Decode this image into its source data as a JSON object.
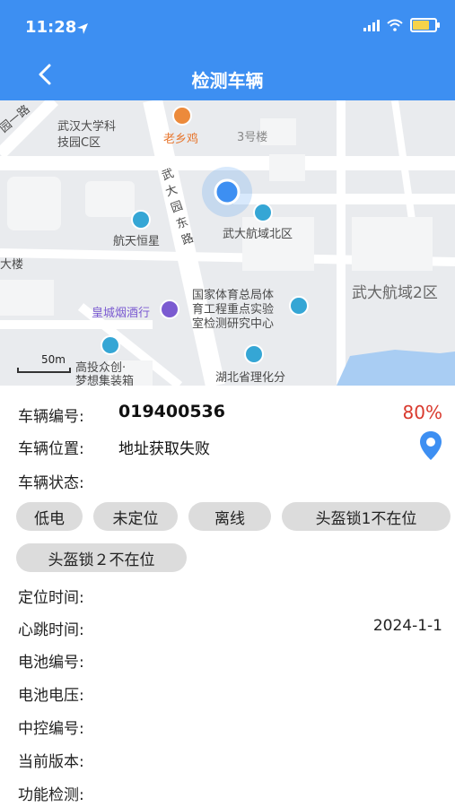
{
  "status": {
    "time": "11:28"
  },
  "header": {
    "title": "检测车辆",
    "back_icon": "back-chevron-icon"
  },
  "map": {
    "labels": [
      "武汉大学科",
      "技园C区",
      "老乡鸡",
      "3号楼",
      "武",
      "大",
      "园",
      "东",
      "路",
      "航天恒星",
      "武大航域北区",
      "武大航域2区",
      "大楼",
      "国家体育总局体",
      "育工程重点实验",
      "室检测研究中心",
      "皇城烟酒行",
      "湖北省理化分",
      "梦想集装箱",
      "高投众创·",
      "50m",
      "园一路"
    ]
  },
  "vehicle": {
    "number_label": "车辆编号:",
    "number_value": "019400536",
    "battery_percent": "80%",
    "location_label": "车辆位置:",
    "location_value": "地址获取失败",
    "status_label": "车辆状态:",
    "tags": [
      "低电",
      "未定位",
      "离线",
      "头盔锁1不在位",
      "头盔锁２不在位"
    ],
    "position_time_label": "定位时间:",
    "heartbeat_label": "心跳时间:",
    "heartbeat_value": "2024-1-1",
    "battery_number_label": "电池编号:",
    "battery_voltage_label": "电池电压:",
    "controller_label": "中控编号:",
    "version_label": "当前版本:",
    "function_label": "功能检测:"
  },
  "colors": {
    "header": "#3d8ff2",
    "accent_red": "#d9392d",
    "location_blue": "#3d8ff2",
    "tag_bg": "#dcdcdc"
  }
}
